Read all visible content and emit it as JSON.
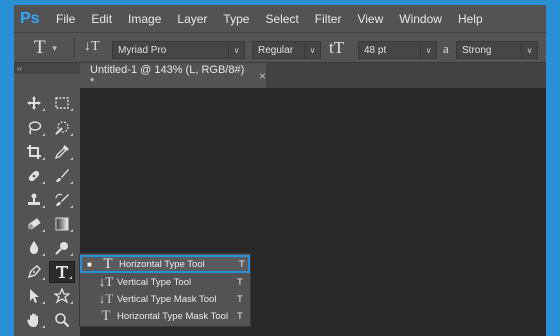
{
  "app": {
    "logo": "Ps"
  },
  "menu": [
    "File",
    "Edit",
    "Image",
    "Layer",
    "Type",
    "Select",
    "Filter",
    "View",
    "Window",
    "Help"
  ],
  "options": {
    "tool_glyph": "T",
    "orientation_glyph": "↓T",
    "font_family": "Myriad Pro",
    "font_style": "Regular",
    "font_size_glyph": "tT",
    "font_size": "48 pt",
    "antialias_glyph": "a",
    "antialias": "Strong"
  },
  "toolbar": {
    "collapse_glyph": "‹‹",
    "active_tool": "type-tool"
  },
  "document": {
    "tab_title": "Untitled-1 @ 143% (L, RGB/8#) *",
    "close_glyph": "×"
  },
  "flyout": [
    {
      "label": "Horizontal Type Tool",
      "shortcut": "T",
      "glyph": "T",
      "selected": true
    },
    {
      "label": "Vertical Type Tool",
      "shortcut": "T",
      "glyph": "↓T",
      "selected": false
    },
    {
      "label": "Vertical Type Mask Tool",
      "shortcut": "T",
      "glyph": "↓T",
      "selected": false
    },
    {
      "label": "Horizontal Type Mask Tool",
      "shortcut": "T",
      "glyph": "T",
      "selected": false
    }
  ],
  "colors": {
    "accent": "#2b8fd6",
    "ps_blue": "#31a8ff",
    "panel": "#535353",
    "canvas": "#282828"
  }
}
